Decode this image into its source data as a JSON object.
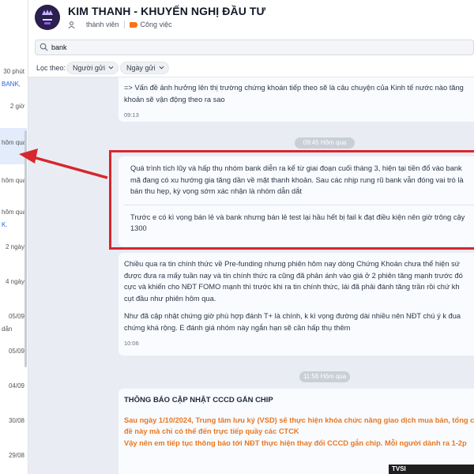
{
  "chat_list": {
    "items": [
      {
        "text": "30 phút"
      },
      {
        "text": "BANK,"
      },
      {
        "text": "2 giờ"
      },
      {
        "text": "hôm qua"
      },
      {
        "text": "hôm qua"
      },
      {
        "text": "hôm qua"
      },
      {
        "text": "K."
      },
      {
        "text": "2 ngày"
      },
      {
        "text": "4 ngày"
      },
      {
        "text": "05/09"
      },
      {
        "text": "dẫn"
      },
      {
        "text": "05/09"
      },
      {
        "text": "04/09"
      },
      {
        "text": "30/08"
      },
      {
        "text": "29/08"
      }
    ]
  },
  "header": {
    "avatar_text": "BAY STOCK VIP",
    "title": "KIM THANH - KHUYẾN NGHỊ ĐẦU TƯ",
    "member_label": "thành viên",
    "tag_label": "Công việc"
  },
  "search": {
    "value": "bank"
  },
  "filters": {
    "label": "Lọc theo:",
    "sender": "Người gửi",
    "date": "Ngày gửi"
  },
  "messages": {
    "m1": {
      "lines": [
        "=> Vấn đề ảnh hưởng lên thị trường chứng khoán tiếp theo sẽ là câu chuyện của Kinh tế nước nào tăng",
        "khoản sẽ vận động theo ra sao"
      ],
      "time": "09:13"
    },
    "divider1": "09:45 Hôm qua",
    "m2": {
      "para1": [
        "Quá trình tích lũy và hấp thụ nhóm bank diễn ra kể từ giai đoạn cuối tháng 3, hiện tại tiền đổ vào bank",
        "mã đang có xu hướng gia tăng dần về mặt thanh khoản. Sau các nhịp rung rũ bank vẫn đóng vai trò là",
        "bán thu hẹp, kỳ vọng sớm xác nhận là nhóm dẫn dắt"
      ],
      "para2": [
        "Trước e có kì vọng bán lẻ và bank nhưng bán lẻ test lại hầu hết bị fail k đạt điều kiện nên giờ trông cậy",
        "1300"
      ]
    },
    "m3": {
      "para1": [
        "Chiều qua ra tin chính thức về Pre-funding nhưng phiên hôm nay dòng Chứng Khoán chưa thể hiện sứ",
        "được đưa ra mấy tuần nay và tin chính thức ra cũng đã phản ánh vào giá ở 2 phiên tăng mạnh trước đó",
        "cực và khiến cho NĐT FOMO mạnh thì trước khi ra tin chính thức, lái đã phải đánh tăng trần rồi chứ kh",
        "cụt đầu như phiên hôm qua."
      ],
      "para2": [
        "Như đã cập nhật chứng giờ phù hợp đánh T+ là chính, k kì vọng đường dài nhiều nên NĐT chú ý k đua",
        "chứng khá rộng. E đánh giá nhóm này ngắn hạn sẽ cần hấp thụ thêm"
      ],
      "time": "10:06"
    },
    "divider2": "11:56 Hôm qua",
    "m4": {
      "title": "THÔNG BÁO CẬP NHẬT CCCD GẮN CHIP",
      "lines": [
        "Sau ngày 1/10/2024, Trung tâm lưu ký (VSD) sẽ thực hiện khóa chức năng giao dịch mua bán, tổng c",
        "đề này mà chỉ có thể đến trực tiếp quầy các CTCK",
        "Vậy nên em tiếp tục thông báo tới NĐT thực hiện thay đổi CCCD gắn chip. Mỗi người dành ra 1-2p"
      ]
    }
  },
  "corner_badge": "TVSI",
  "colors": {
    "accent": "#d7262e",
    "orange_text": "#e87722",
    "tag": "#f97316",
    "active_row": "#e3ecfb"
  }
}
